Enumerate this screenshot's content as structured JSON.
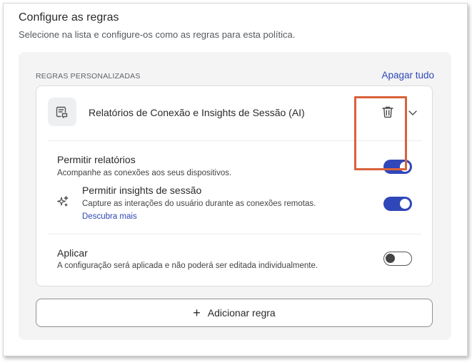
{
  "header": {
    "title": "Configure as regras",
    "subtitle": "Selecione na lista e configure-os como as regras para esta política."
  },
  "rules": {
    "section_label": "REGRAS PERSONALIZADAS",
    "clear_all_label": "Apagar tudo",
    "card": {
      "title": "Relatórios de Conexão e Insights de Sessão (AI)",
      "options": [
        {
          "title": "Permitir relatórios",
          "description": "Acompanhe as conexões aos seus dispositivos.",
          "enabled": true
        },
        {
          "title": "Permitir insights de sessão",
          "description": "Capture as interações do usuário durante as conexões remotas.",
          "link": "Descubra mais",
          "enabled": true
        }
      ],
      "apply": {
        "title": "Aplicar",
        "description": "A configuração será aplicada e não poderá ser editada individualmente.",
        "enabled": false
      }
    }
  },
  "add_rule": {
    "icon": "+",
    "label": "Adicionar regra"
  },
  "colors": {
    "accent": "#2f47b8",
    "link": "#2e47b5",
    "highlight": "#d9623b",
    "panel_bg": "#f4f4f5"
  }
}
